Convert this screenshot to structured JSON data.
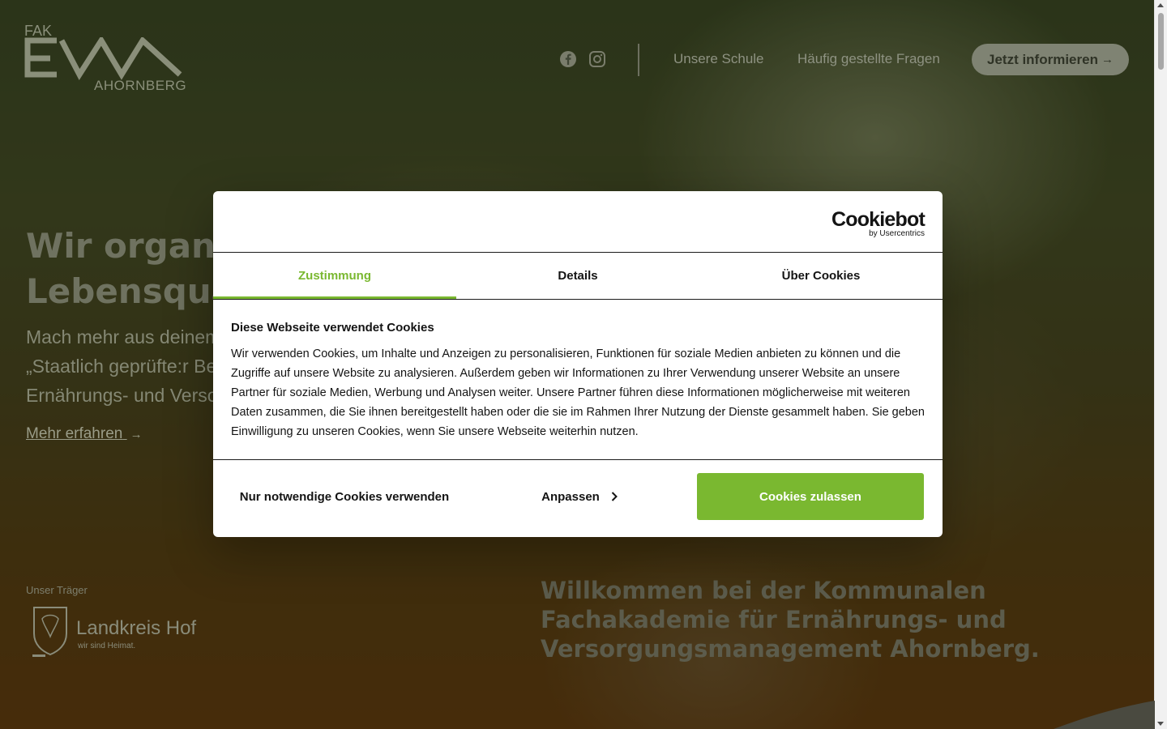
{
  "header": {
    "logo_top": "FAK",
    "logo_bottom": "AHORNBERG",
    "nav": [
      "Unsere Schule",
      "Häufig gestellte Fragen"
    ],
    "cta_label": "Jetzt informieren",
    "cta_arrow": "→"
  },
  "hero": {
    "title_line1": "Wir organis",
    "title_line2": "Lebensqua",
    "sub_line1": "Mach mehr aus deinem",
    "sub_line2": "„Staatlich geprüfte:r Be",
    "sub_line3": "Ernährungs- und Versor",
    "more_label": "Mehr erfahren",
    "more_arrow": "→"
  },
  "traeger": {
    "label": "Unser Träger",
    "name": "Landkreis Hof",
    "tagline": "wir sind Heimat."
  },
  "welcome": {
    "title": "Willkommen bei der Kommunalen Fachakademie für Ernährungs- und Versorgungsmanagement Ahornberg."
  },
  "cookie_dialog": {
    "brand": "Cookiebot",
    "brand_sub": "by Usercentrics",
    "tabs": [
      {
        "label": "Zustimmung",
        "active": true
      },
      {
        "label": "Details",
        "active": false
      },
      {
        "label": "Über Cookies",
        "active": false
      }
    ],
    "heading": "Diese Webseite verwendet Cookies",
    "text": "Wir verwenden Cookies, um Inhalte und Anzeigen zu personalisieren, Funktionen für soziale Medien anbieten zu können und die Zugriffe auf unsere Website zu analysieren. Außerdem geben wir Informationen zu Ihrer Verwendung unserer Website an unsere Partner für soziale Medien, Werbung und Analysen weiter. Unsere Partner führen diese Informationen möglicherweise mit weiteren Daten zusammen, die Sie ihnen bereitgestellt haben oder die sie im Rahmen Ihrer Nutzung der Dienste gesammelt haben. Sie geben Einwilligung zu unseren Cookies, wenn Sie unsere Webseite weiterhin nutzen.",
    "buttons": {
      "necessary": "Nur notwendige Cookies verwenden",
      "customize": "Anpassen",
      "allow": "Cookies zulassen"
    }
  },
  "colors": {
    "accent_green": "#7ab830"
  },
  "icons": [
    "facebook-icon",
    "instagram-icon",
    "chevron-right-icon",
    "arrow-right-icon"
  ]
}
